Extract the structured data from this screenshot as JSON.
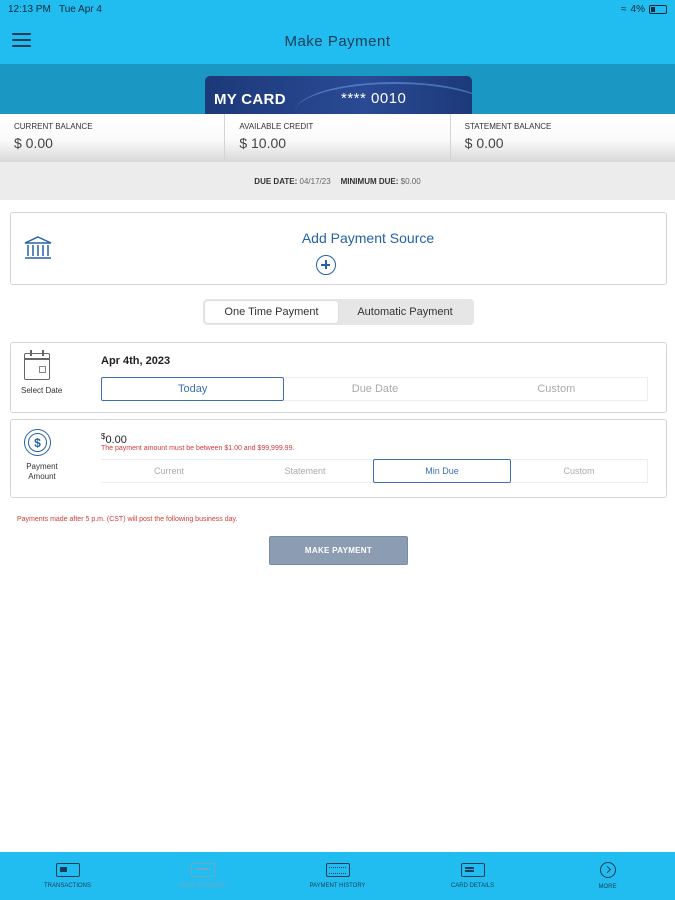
{
  "status_bar": {
    "time": "12:13 PM",
    "date": "Tue Apr 4",
    "battery": "4%"
  },
  "header": {
    "title": "Make Payment"
  },
  "card": {
    "name": "MY CARD",
    "number": "**** 0010"
  },
  "balances": [
    {
      "label": "CURRENT BALANCE",
      "value": "$ 0.00"
    },
    {
      "label": "AVAILABLE CREDIT",
      "value": "$ 10.00"
    },
    {
      "label": "STATEMENT BALANCE",
      "value": "$ 0.00"
    }
  ],
  "due": {
    "due_date_label": "DUE DATE:",
    "due_date": "04/17/23",
    "min_due_label": "MINIMUM DUE:",
    "min_due": "$0.00"
  },
  "payment_source": {
    "label": "Add Payment Source"
  },
  "payment_type": {
    "one_time": "One Time Payment",
    "automatic": "Automatic Payment",
    "selected": "one_time"
  },
  "date_section": {
    "label": "Select Date",
    "value": "Apr 4th, 2023",
    "options": [
      "Today",
      "Due Date",
      "Custom"
    ],
    "selected": "Today"
  },
  "amount_section": {
    "label": "Payment Amount",
    "currency": "$",
    "value": "0.00",
    "error": "The payment amount must be between $1.00 and $99,999.99.",
    "options": [
      "Current",
      "Statement",
      "Min Due",
      "Custom"
    ],
    "selected": "Min Due"
  },
  "note": "Payments made after 5 p.m. (CST) will post the following business day.",
  "make_payment_label": "MAKE PAYMENT",
  "tabs": [
    {
      "label": "TRANSACTIONS",
      "icon": "card-icon",
      "active": true
    },
    {
      "label": "MAKE PAYMENT",
      "icon": "payment-card-icon",
      "active": false
    },
    {
      "label": "PAYMENT HISTORY",
      "icon": "history-icon",
      "active": true
    },
    {
      "label": "CARD DETAILS",
      "icon": "details-icon",
      "active": true
    },
    {
      "label": "MORE",
      "icon": "more-icon",
      "active": true
    }
  ],
  "colors": {
    "header": "#21bdf0",
    "accent": "#2561a8",
    "error": "#d23b3b",
    "button": "#8c9cb2"
  }
}
